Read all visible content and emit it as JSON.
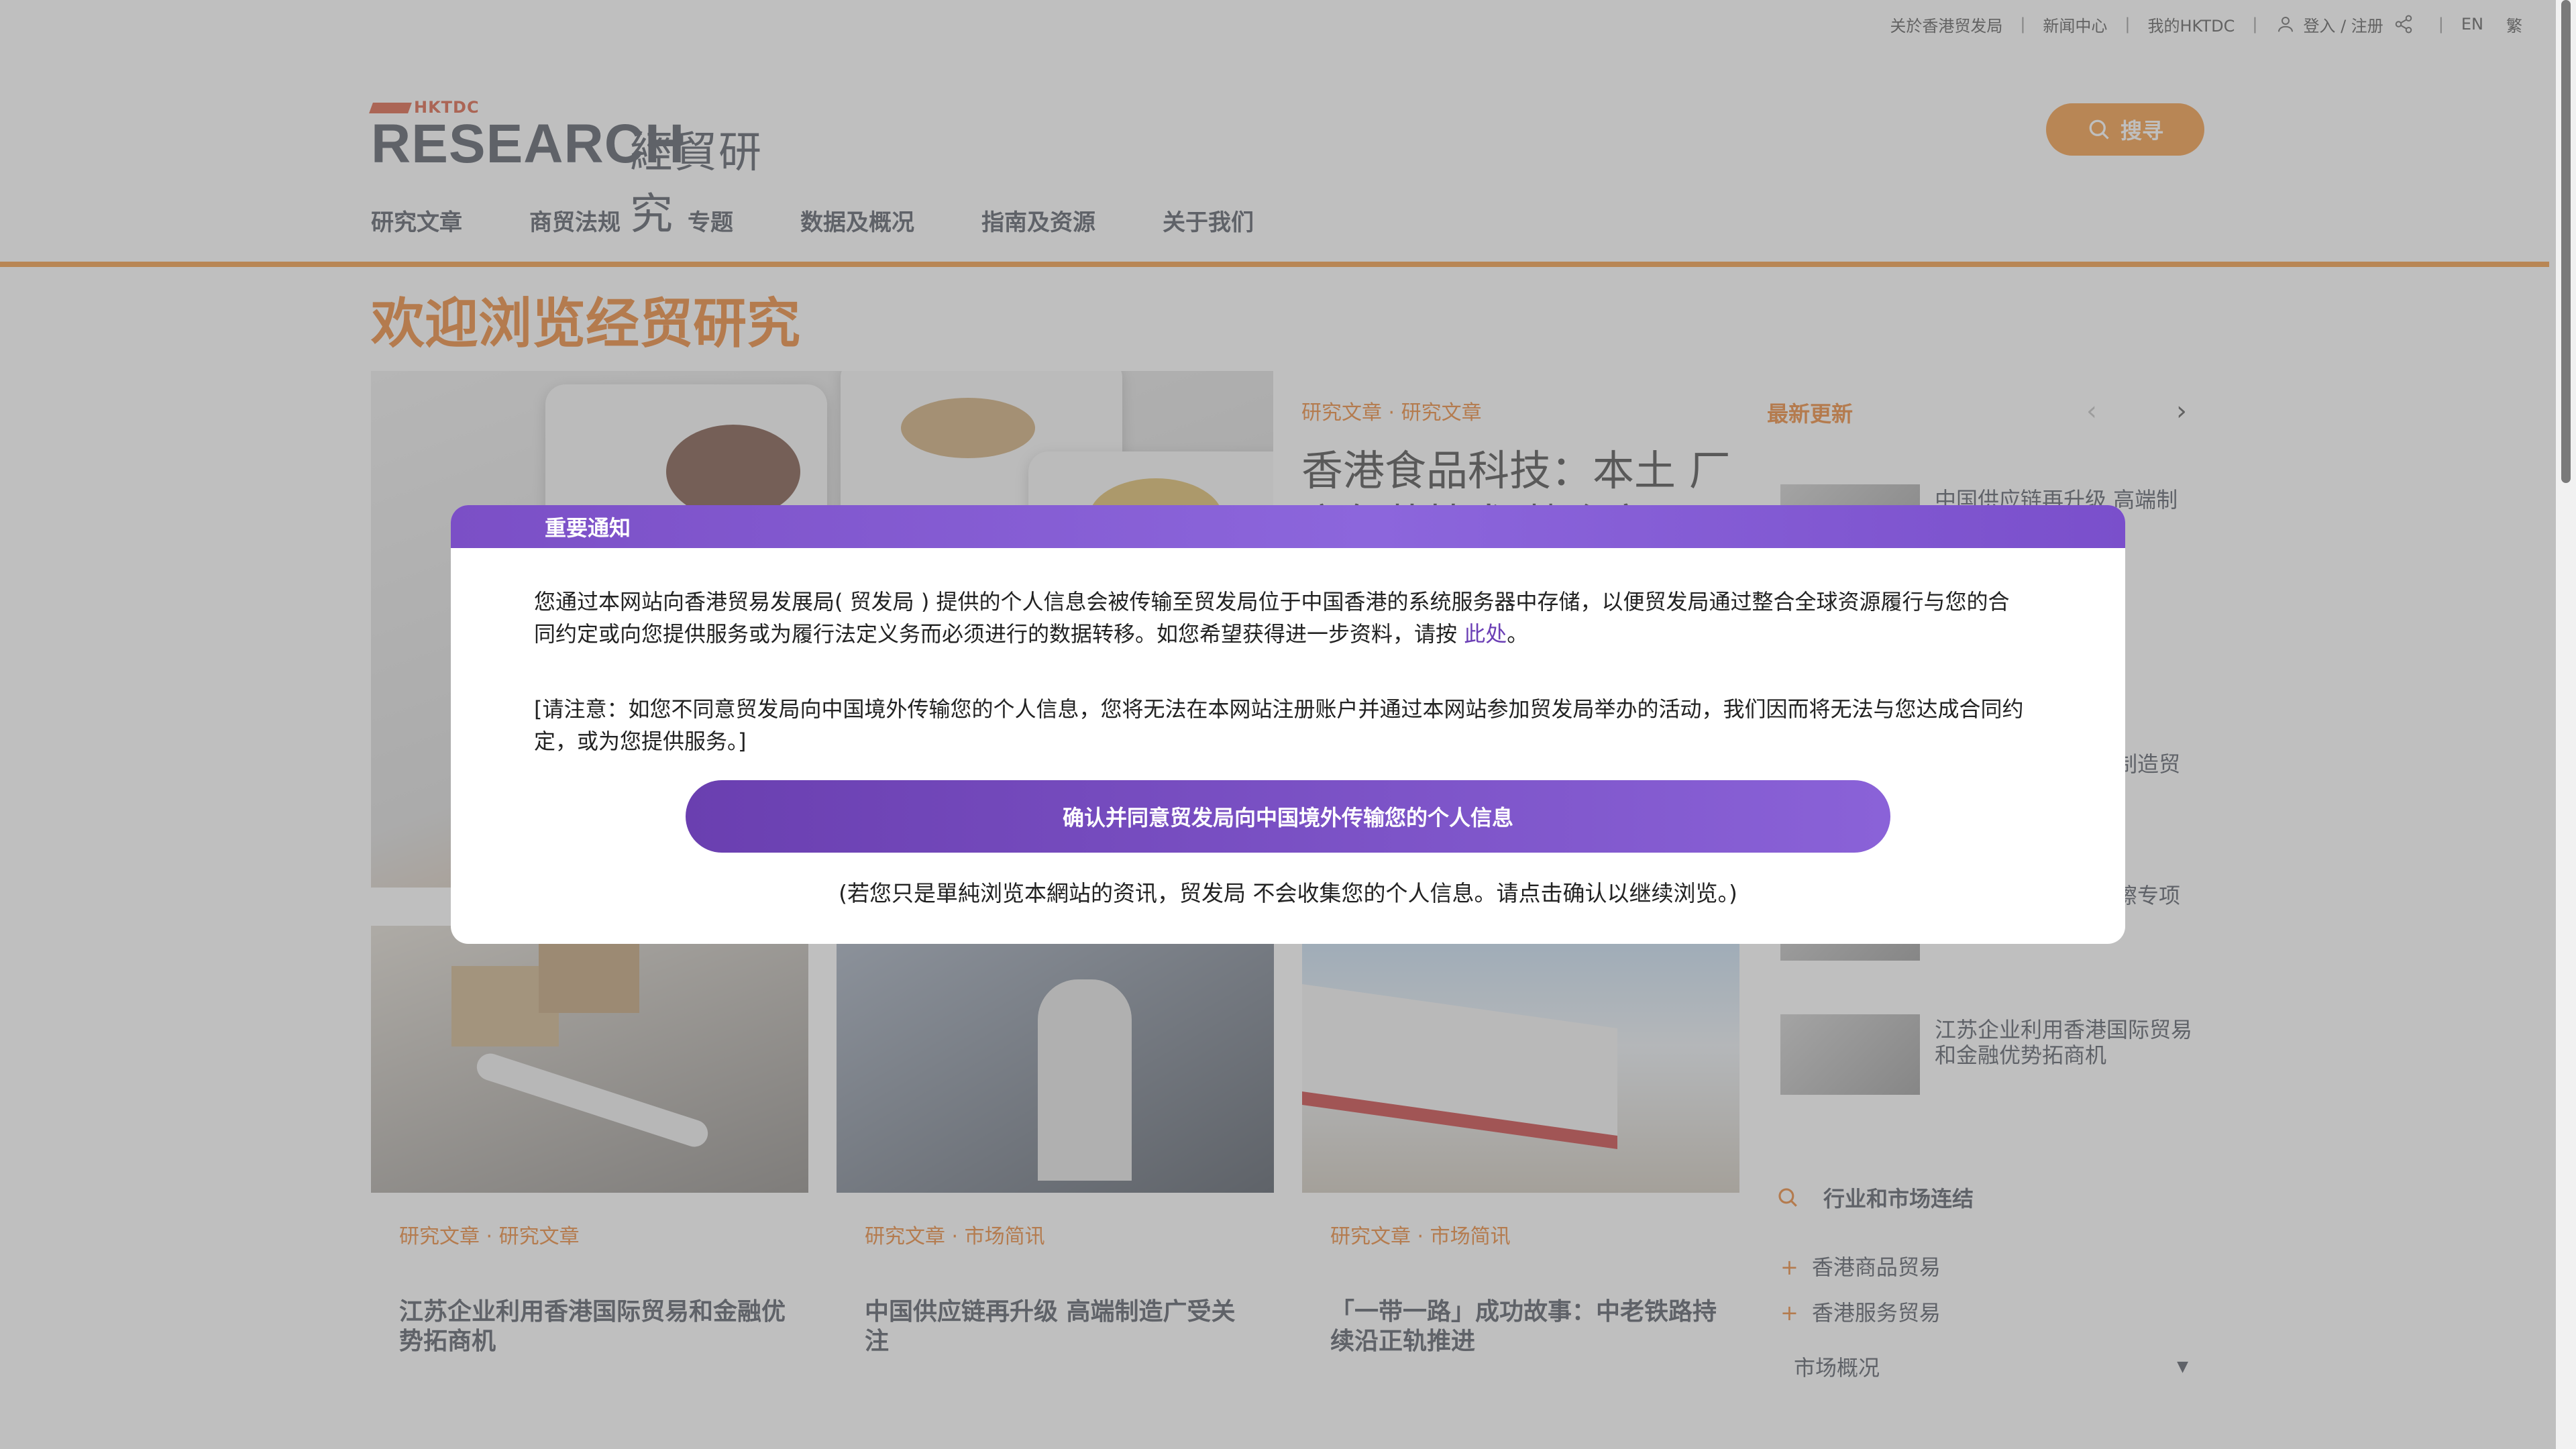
{
  "utility": {
    "about": "关於香港贸发局",
    "news": "新闻中心",
    "my": "我的HKTDC",
    "login": "登入 / 注册",
    "lang_en": "EN",
    "lang_tc": "繁",
    "separator": "|"
  },
  "header": {
    "logo_small": "HKTDC",
    "logo_main": "RESEARCH",
    "logo_cn": "經貿研究",
    "search_label": "搜寻"
  },
  "nav": [
    "研究文章",
    "商贸法规",
    "专题",
    "数据及概况",
    "指南及资源",
    "关于我们"
  ],
  "main": {
    "welcome": "欢迎浏览经贸研究",
    "hero": {
      "category": "研究文章 · 研究文章",
      "title": "香港食品科技：本土 厂商包装技术 勢合突"
    },
    "latest_label": "最新更新",
    "arrows": {
      "prev": "‹",
      "next": "›"
    },
    "sidebar_items": [
      "中国供应链再升级 高端制",
      "制造贸",
      "擦专项",
      "江苏企业利用香港国际贸易和金融优势拓商机"
    ],
    "cards": [
      {
        "category": "研究文章 · 研究文章",
        "title": "江苏企业利用香港国际贸易和金融优势拓商机"
      },
      {
        "category": "研究文章 · 市场简讯",
        "title": "中国供应链再升级 高端制造广受关注"
      },
      {
        "category": "研究文章 · 市场简讯",
        "title": "「一带一路」成功故事：中老铁路持续沿正轨推进"
      }
    ],
    "industry_links": "行业和市场连结",
    "plus_items": [
      "香港商品贸易",
      "香港服务贸易"
    ],
    "market_overview": "市场概况"
  },
  "modal": {
    "title": "重要通知",
    "para1": "您通过本网站向香港贸易发展局( 贸发局 ) 提供的个人信息会被传输至贸发局位于中国香港的系统服务器中存储，以便贸发局通过整合全球资源履行与您的合同约定或向您提供服务或为履行法定义务而必须进行的数据转移。如您希望获得进一步资料，请按 ",
    "para1_link": "此处",
    "para1_end": "。",
    "para2": "[请注意：如您不同意贸发局向中国境外传输您的个人信息，您将无法在本网站注册账户并通过本网站参加贸发局举办的活动，我们因而将无法与您达成合同约定，或为您提供服务。]",
    "confirm_label": "确认并同意贸发局向中国境外传输您的个人信息",
    "footnote": "(若您只是單純浏览本網站的资讯，贸发局 不会收集您的个人信息。请点击确认以继续浏览。)"
  },
  "colors": {
    "brand_orange": "#f08c2a",
    "modal_purple": "#7b4fc6",
    "overlay": "rgba(128,128,128,0.5)"
  }
}
